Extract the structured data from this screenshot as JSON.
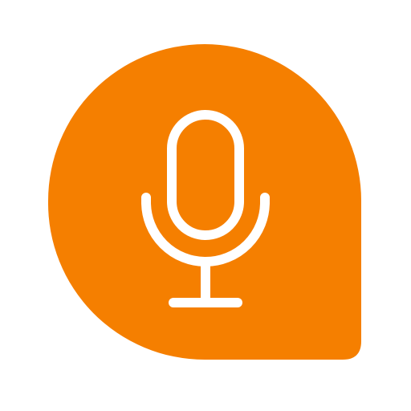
{
  "icon": {
    "name": "microphone-speech-bubble-icon",
    "colors": {
      "bubble": "#F57F00",
      "glyph": "#FFFFFF",
      "background": "#FFFFFF"
    }
  }
}
